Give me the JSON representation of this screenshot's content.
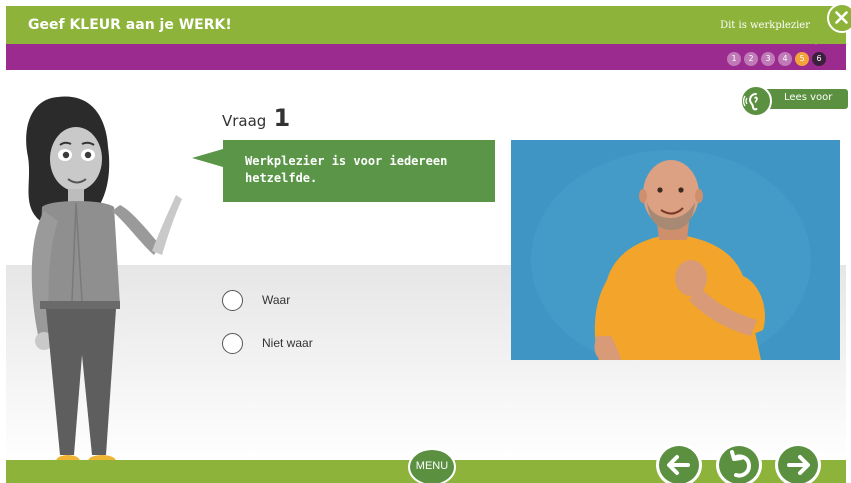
{
  "header": {
    "app_title": "Geef KLEUR aan je WERK!",
    "section_title": "Dit is werkplezier",
    "close_icon": "close-icon"
  },
  "progress": {
    "steps": [
      "1",
      "2",
      "3",
      "4",
      "5",
      "6"
    ],
    "current_step": "5",
    "active_step": "6"
  },
  "read_aloud": {
    "label": "Lees voor",
    "icon": "ear-speaker-icon"
  },
  "question": {
    "word": "Vraag",
    "number": "1",
    "statement": "Werkplezier is voor iedereen hetzelfde.",
    "options": [
      "Waar",
      "Niet waar"
    ]
  },
  "footer": {
    "menu_label": "MENU",
    "back_icon": "arrow-left-icon",
    "retry_icon": "retry-icon",
    "next_icon": "arrow-right-icon"
  },
  "colors": {
    "topbar": "#8db33a",
    "progress_bar": "#9b2b8e",
    "button_green": "#5b9040",
    "bubble_green": "#5b9648",
    "photo_background": "#3f95c3",
    "shirt": "#f2a52a"
  }
}
